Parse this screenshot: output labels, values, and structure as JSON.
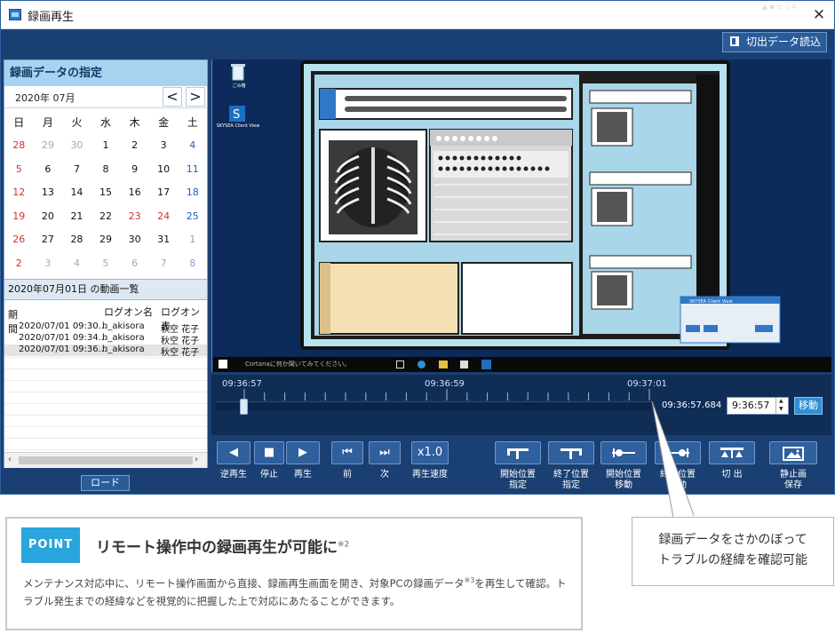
{
  "window": {
    "title": "録画再生",
    "close_label": "✕",
    "load_cut_label": "切出データ読込"
  },
  "calendar": {
    "header": "録画データの指定",
    "month_label": "2020年 07月",
    "prev_label": "<",
    "next_label": ">",
    "weekdays": [
      "日",
      "月",
      "火",
      "水",
      "木",
      "金",
      "土"
    ],
    "weeks": [
      [
        "28",
        "29",
        "30",
        "1",
        "2",
        "3",
        "4"
      ],
      [
        "5",
        "6",
        "7",
        "8",
        "9",
        "10",
        "11"
      ],
      [
        "12",
        "13",
        "14",
        "15",
        "16",
        "17",
        "18"
      ],
      [
        "19",
        "20",
        "21",
        "22",
        "23",
        "24",
        "25"
      ],
      [
        "26",
        "27",
        "28",
        "29",
        "30",
        "31",
        "1"
      ],
      [
        "2",
        "3",
        "4",
        "5",
        "6",
        "7",
        "8"
      ]
    ],
    "holidays": [
      "23",
      "24"
    ]
  },
  "video_list": {
    "header": "2020年07月01日 の動画一覧",
    "columns": [
      "期間",
      "ログオン名",
      "ログオン表"
    ],
    "rows": [
      {
        "period": "2020/07/01 09:30...",
        "logon": "h_akisora",
        "display": "秋空 花子"
      },
      {
        "period": "2020/07/01 09:34...",
        "logon": "h_akisora",
        "display": "秋空 花子"
      },
      {
        "period": "2020/07/01 09:36...",
        "logon": "h_akisora",
        "display": "秋空 花子"
      }
    ],
    "load_label": "ロード"
  },
  "screen": {
    "desktop_icons": [
      "ごみ箱",
      "SKYSEA Client View"
    ],
    "taskbar_search": "Cortanaに何か聞いてみてください。",
    "taskbar_tray": "▲ ▪ ▫ ◁ A",
    "popup_title": "SKYSEA Client View"
  },
  "timeline": {
    "labels": [
      "09:36:57",
      "09:36:59",
      "09:37:01"
    ],
    "current_time": "09:36:57.684",
    "jump_value": "9:36:57",
    "move_label": "移動"
  },
  "controls": [
    {
      "name": "reverse-play-button",
      "icon": "◀",
      "label": "逆再生"
    },
    {
      "name": "stop-button",
      "icon": "■",
      "label": "停止"
    },
    {
      "name": "play-button",
      "icon": "▶",
      "label": "再生"
    },
    {
      "name": "prev-button",
      "icon": "⏮",
      "label": "前"
    },
    {
      "name": "next-button",
      "icon": "⏭",
      "label": "次"
    },
    {
      "name": "speed-button",
      "icon": "x1.0",
      "label": "再生速度"
    },
    {
      "name": "set-start-button",
      "icon": "",
      "label": "開始位置\n指定"
    },
    {
      "name": "set-end-button",
      "icon": "",
      "label": "終了位置\n指定"
    },
    {
      "name": "goto-start-button",
      "icon": "",
      "label": "開始位置\n移動"
    },
    {
      "name": "goto-end-button",
      "icon": "",
      "label": "終了位置\n移動"
    },
    {
      "name": "cut-button",
      "icon": "",
      "label": "切 出"
    },
    {
      "name": "save-still-button",
      "icon": "",
      "label": "静止画\n保存"
    }
  ],
  "point": {
    "badge": "POINT",
    "title": "リモート操作中の録画再生が可能に",
    "title_note": "※2",
    "body_part1": "メンテナンス対応中に、リモート操作画面から直接、録画再生画面を開き、対象PCの録画データ",
    "body_note": "※3",
    "body_part2": "を再生して確認。トラブル発生までの経緯などを視覚的に把握した上で対応にあたることができます。"
  },
  "callout": {
    "line1": "録画データをさかのぼって",
    "line2": "トラブルの経緯を確認可能"
  },
  "colors": {
    "window_bg": "#1a3f72",
    "accent": "#2aa5dd",
    "button": "#2f5f9d"
  }
}
